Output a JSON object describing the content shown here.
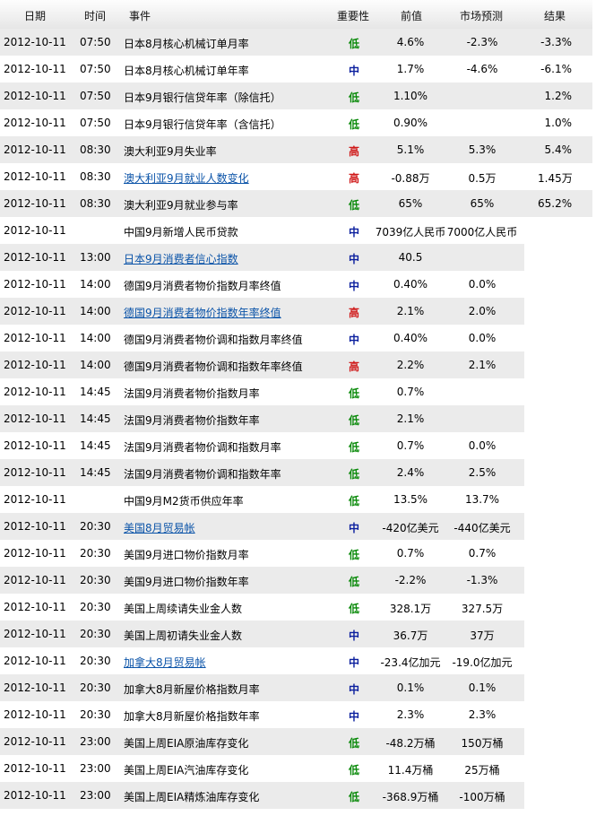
{
  "header": {
    "date": "日期",
    "time": "时间",
    "event": "事件",
    "importance": "重要性",
    "previous": "前值",
    "forecast": "市场预测",
    "actual": "结果"
  },
  "importance_colors": {
    "低": "#0a8a0a",
    "中": "#0b1f9e",
    "高": "#d01a1a"
  },
  "colors": {
    "header_bg": "#e9e9e9",
    "row_shade": "#ebebeb",
    "link": "#0a53a8"
  },
  "rows": [
    {
      "date": "2012-10-11",
      "time": "07:50",
      "event": "日本8月核心机械订单月率",
      "link": false,
      "importance": "低",
      "previous": "4.6%",
      "forecast": "-2.3%",
      "actual": "-3.3%"
    },
    {
      "date": "2012-10-11",
      "time": "07:50",
      "event": "日本8月核心机械订单年率",
      "link": false,
      "importance": "中",
      "previous": "1.7%",
      "forecast": "-4.6%",
      "actual": "-6.1%"
    },
    {
      "date": "2012-10-11",
      "time": "07:50",
      "event": "日本9月银行信贷年率（除信托）",
      "link": false,
      "importance": "低",
      "previous": "1.10%",
      "forecast": "",
      "actual": "1.2%"
    },
    {
      "date": "2012-10-11",
      "time": "07:50",
      "event": "日本9月银行信贷年率（含信托）",
      "link": false,
      "importance": "低",
      "previous": "0.90%",
      "forecast": "",
      "actual": "1.0%"
    },
    {
      "date": "2012-10-11",
      "time": "08:30",
      "event": "澳大利亚9月失业率",
      "link": false,
      "importance": "高",
      "previous": "5.1%",
      "forecast": "5.3%",
      "actual": "5.4%"
    },
    {
      "date": "2012-10-11",
      "time": "08:30",
      "event": "澳大利亚9月就业人数变化",
      "link": true,
      "importance": "高",
      "previous": "-0.88万",
      "forecast": "0.5万",
      "actual": "1.45万"
    },
    {
      "date": "2012-10-11",
      "time": "08:30",
      "event": "澳大利亚9月就业参与率",
      "link": false,
      "importance": "低",
      "previous": "65%",
      "forecast": "65%",
      "actual": "65.2%"
    },
    {
      "date": "2012-10-11",
      "time": "",
      "event": "中国9月新增人民币贷款",
      "link": false,
      "importance": "中",
      "previous": "7039亿人民币",
      "forecast": "7000亿人民币",
      "actual": ""
    },
    {
      "date": "2012-10-11",
      "time": "13:00",
      "event": "日本9月消费者信心指数",
      "link": true,
      "importance": "中",
      "previous": "40.5",
      "forecast": "",
      "actual": ""
    },
    {
      "date": "2012-10-11",
      "time": "14:00",
      "event": "德国9月消费者物价指数月率终值",
      "link": false,
      "importance": "中",
      "previous": "0.40%",
      "forecast": "0.0%",
      "actual": ""
    },
    {
      "date": "2012-10-11",
      "time": "14:00",
      "event": "德国9月消费者物价指数年率终值",
      "link": true,
      "importance": "高",
      "previous": "2.1%",
      "forecast": "2.0%",
      "actual": ""
    },
    {
      "date": "2012-10-11",
      "time": "14:00",
      "event": "德国9月消费者物价调和指数月率终值",
      "link": false,
      "importance": "中",
      "previous": "0.40%",
      "forecast": "0.0%",
      "actual": ""
    },
    {
      "date": "2012-10-11",
      "time": "14:00",
      "event": "德国9月消费者物价调和指数年率终值",
      "link": false,
      "importance": "高",
      "previous": "2.2%",
      "forecast": "2.1%",
      "actual": ""
    },
    {
      "date": "2012-10-11",
      "time": "14:45",
      "event": "法国9月消费者物价指数月率",
      "link": false,
      "importance": "低",
      "previous": "0.7%",
      "forecast": "",
      "actual": ""
    },
    {
      "date": "2012-10-11",
      "time": "14:45",
      "event": "法国9月消费者物价指数年率",
      "link": false,
      "importance": "低",
      "previous": "2.1%",
      "forecast": "",
      "actual": ""
    },
    {
      "date": "2012-10-11",
      "time": "14:45",
      "event": "法国9月消费者物价调和指数月率",
      "link": false,
      "importance": "低",
      "previous": "0.7%",
      "forecast": "0.0%",
      "actual": ""
    },
    {
      "date": "2012-10-11",
      "time": "14:45",
      "event": "法国9月消费者物价调和指数年率",
      "link": false,
      "importance": "低",
      "previous": "2.4%",
      "forecast": "2.5%",
      "actual": ""
    },
    {
      "date": "2012-10-11",
      "time": "",
      "event": "中国9月M2货币供应年率",
      "link": false,
      "importance": "低",
      "previous": "13.5%",
      "forecast": "13.7%",
      "actual": ""
    },
    {
      "date": "2012-10-11",
      "time": "20:30",
      "event": "美国8月贸易帐",
      "link": true,
      "importance": "中",
      "previous": "-420亿美元",
      "forecast": "-440亿美元",
      "actual": ""
    },
    {
      "date": "2012-10-11",
      "time": "20:30",
      "event": "美国9月进口物价指数月率",
      "link": false,
      "importance": "低",
      "previous": "0.7%",
      "forecast": "0.7%",
      "actual": ""
    },
    {
      "date": "2012-10-11",
      "time": "20:30",
      "event": "美国9月进口物价指数年率",
      "link": false,
      "importance": "低",
      "previous": "-2.2%",
      "forecast": "-1.3%",
      "actual": ""
    },
    {
      "date": "2012-10-11",
      "time": "20:30",
      "event": "美国上周续请失业金人数",
      "link": false,
      "importance": "低",
      "previous": "328.1万",
      "forecast": "327.5万",
      "actual": ""
    },
    {
      "date": "2012-10-11",
      "time": "20:30",
      "event": "美国上周初请失业金人数",
      "link": false,
      "importance": "中",
      "previous": "36.7万",
      "forecast": "37万",
      "actual": ""
    },
    {
      "date": "2012-10-11",
      "time": "20:30",
      "event": "加拿大8月贸易帐",
      "link": true,
      "importance": "中",
      "previous": "-23.4亿加元",
      "forecast": "-19.0亿加元",
      "actual": ""
    },
    {
      "date": "2012-10-11",
      "time": "20:30",
      "event": "加拿大8月新屋价格指数月率",
      "link": false,
      "importance": "中",
      "previous": "0.1%",
      "forecast": "0.1%",
      "actual": ""
    },
    {
      "date": "2012-10-11",
      "time": "20:30",
      "event": "加拿大8月新屋价格指数年率",
      "link": false,
      "importance": "中",
      "previous": "2.3%",
      "forecast": "2.3%",
      "actual": ""
    },
    {
      "date": "2012-10-11",
      "time": "23:00",
      "event": "美国上周EIA原油库存变化",
      "link": false,
      "importance": "低",
      "previous": "-48.2万桶",
      "forecast": "150万桶",
      "actual": ""
    },
    {
      "date": "2012-10-11",
      "time": "23:00",
      "event": "美国上周EIA汽油库存变化",
      "link": false,
      "importance": "低",
      "previous": "11.4万桶",
      "forecast": "25万桶",
      "actual": ""
    },
    {
      "date": "2012-10-11",
      "time": "23:00",
      "event": "美国上周EIA精炼油库存变化",
      "link": false,
      "importance": "低",
      "previous": "-368.9万桶",
      "forecast": "-100万桶",
      "actual": ""
    }
  ]
}
